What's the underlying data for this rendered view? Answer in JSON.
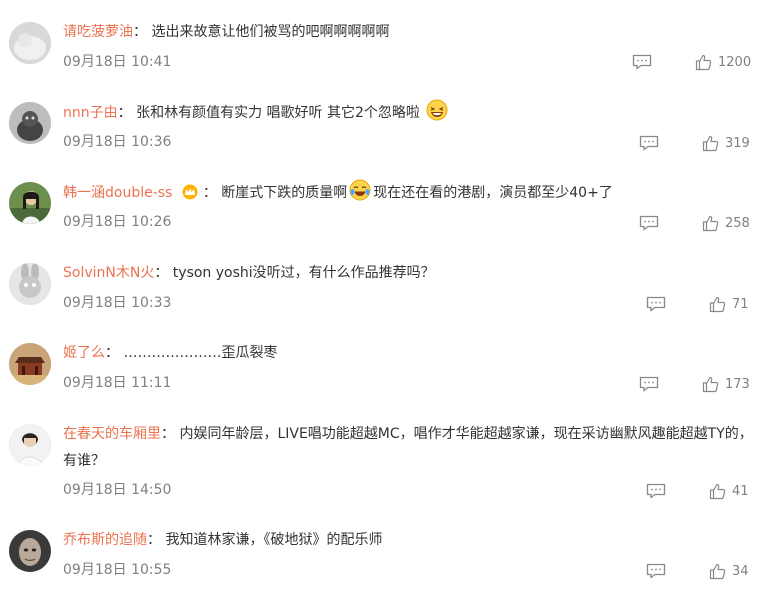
{
  "comments": [
    {
      "name": "请吃菠萝油",
      "sep": "：",
      "text": "选出来故意让他们被骂的吧啊啊啊啊啊",
      "time": "09月18日 10:41",
      "likes": "1200"
    },
    {
      "name": "nnn子由",
      "sep": "：",
      "text": "张和林有颜值有实力 唱歌好听 其它2个忽略啦",
      "time": "09月18日 10:36",
      "likes": "319"
    },
    {
      "name": "韩一涵double-ss",
      "sep": "：",
      "text_a": "断崖式下跌的质量啊",
      "text_b": "现在还在看的港剧，演员都至少40+了",
      "time": "09月18日 10:26",
      "likes": "258"
    },
    {
      "name": "SolvinN木N火",
      "sep": "：",
      "text": "tyson yoshi没听过，有什么作品推荐吗？",
      "time": "09月18日 10:33",
      "likes": "71"
    },
    {
      "name": "姬了么",
      "sep": "：",
      "text": "…………………歪瓜裂枣",
      "time": "09月18日 11:11",
      "likes": "173"
    },
    {
      "name": "在春天的车厢里",
      "sep": "：",
      "text": "内娱同年龄层，LIVE唱功能超越MC，唱作才华能超越家谦，现在采访幽默风趣能超越TY的，有谁？",
      "time": "09月18日 14:50",
      "likes": "41"
    },
    {
      "name": "乔布斯的追随",
      "sep": "：",
      "text": "我知道林家谦，《破地狱》的配乐师",
      "time": "09月18日 10:55",
      "likes": "34"
    }
  ],
  "icons": {
    "reply": "comment-icon",
    "like": "thumbs-up-icon"
  },
  "colors": {
    "name": "#eb7350",
    "meta": "#808080",
    "text": "#333333"
  }
}
